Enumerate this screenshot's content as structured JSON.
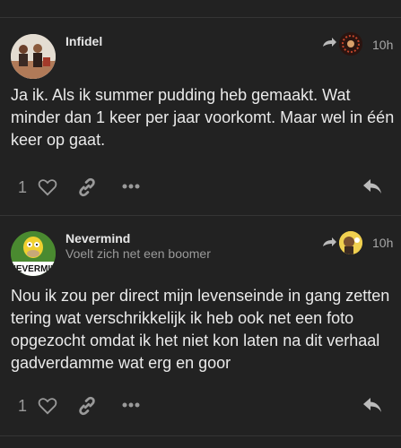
{
  "posts": [
    {
      "username": "Infidel",
      "subtitle": "",
      "time": "10h",
      "body": "Ja ik. Als ik summer pudding heb gemaakt. Wat minder dan 1 keer per jaar voorkomt. Maar wel in één keer op gaat.",
      "likes": "1",
      "icons": {
        "avatar": "user-avatar",
        "reply_to": "reply-to-arrow-icon",
        "like": "heart-icon",
        "link": "link-icon",
        "more": "more-dots-icon",
        "reply": "reply-icon"
      }
    },
    {
      "username": "Nevermind",
      "subtitle": "Voelt zich net een boomer",
      "time": "10h",
      "body": "Nou ik zou per direct mijn levenseinde in gang zetten tering wat verschrikkelijk ik heb ook net een foto opgezocht omdat ik het niet kon laten na dit verhaal gadverdamme wat erg en goor",
      "likes": "1",
      "avatar_text": "NEVERMIN",
      "icons": {
        "avatar": "user-avatar",
        "reply_to": "reply-to-arrow-icon",
        "like": "heart-icon",
        "link": "link-icon",
        "more": "more-dots-icon",
        "reply": "reply-icon"
      }
    }
  ],
  "colors": {
    "background": "#222222",
    "text": "#eaeaea",
    "muted": "#9a9a9a",
    "divider": "#353535"
  }
}
